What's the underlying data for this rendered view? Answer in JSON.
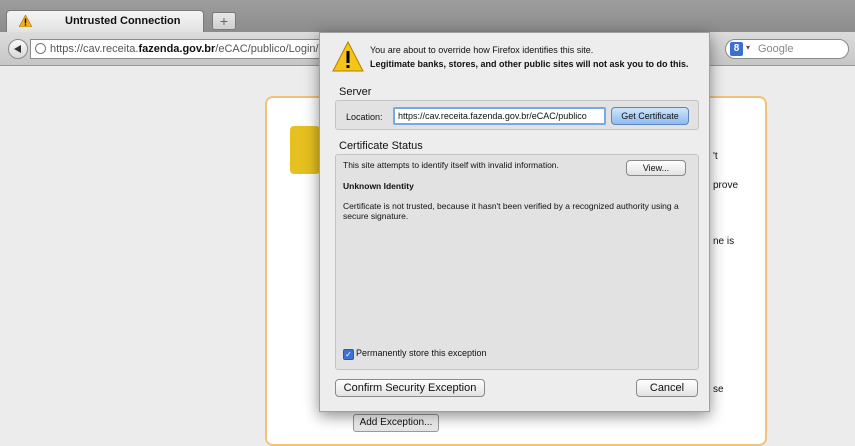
{
  "tab": {
    "title": "Untrusted Connection",
    "new_tab_symbol": "+"
  },
  "navbar": {
    "url_prefix": "https://cav.receita.",
    "url_domain": "fazenda.gov.br",
    "url_suffix": "/eCAC/publico/Login/",
    "search_placeholder": "Google",
    "search_engine_icon": "google-icon"
  },
  "background": {
    "fragment_t": "'t",
    "fragment_prove": "prove",
    "fragment_ne_is": "ne is",
    "fragment_se": "se",
    "add_exception_label": "Add Exception..."
  },
  "dialog": {
    "line1": "You are about to override how Firefox identifies this site.",
    "line2": "Legitimate banks, stores, and other public sites will not ask you to do this.",
    "server_heading": "Server",
    "location_label": "Location:",
    "location_value": "https://cav.receita.fazenda.gov.br/eCAC/publico",
    "get_certificate_label": "Get Certificate",
    "cert_status_heading": "Certificate Status",
    "status_text": "This site attempts to identify itself with invalid information.",
    "view_label": "View...",
    "unknown_identity": "Unknown Identity",
    "detail_text": "Certificate is not trusted, because it hasn't been verified by a recognized authority using a secure signature.",
    "permanent_label": "Permanently store this exception",
    "permanent_checked": true,
    "confirm_label": "Confirm Security Exception",
    "cancel_label": "Cancel"
  }
}
